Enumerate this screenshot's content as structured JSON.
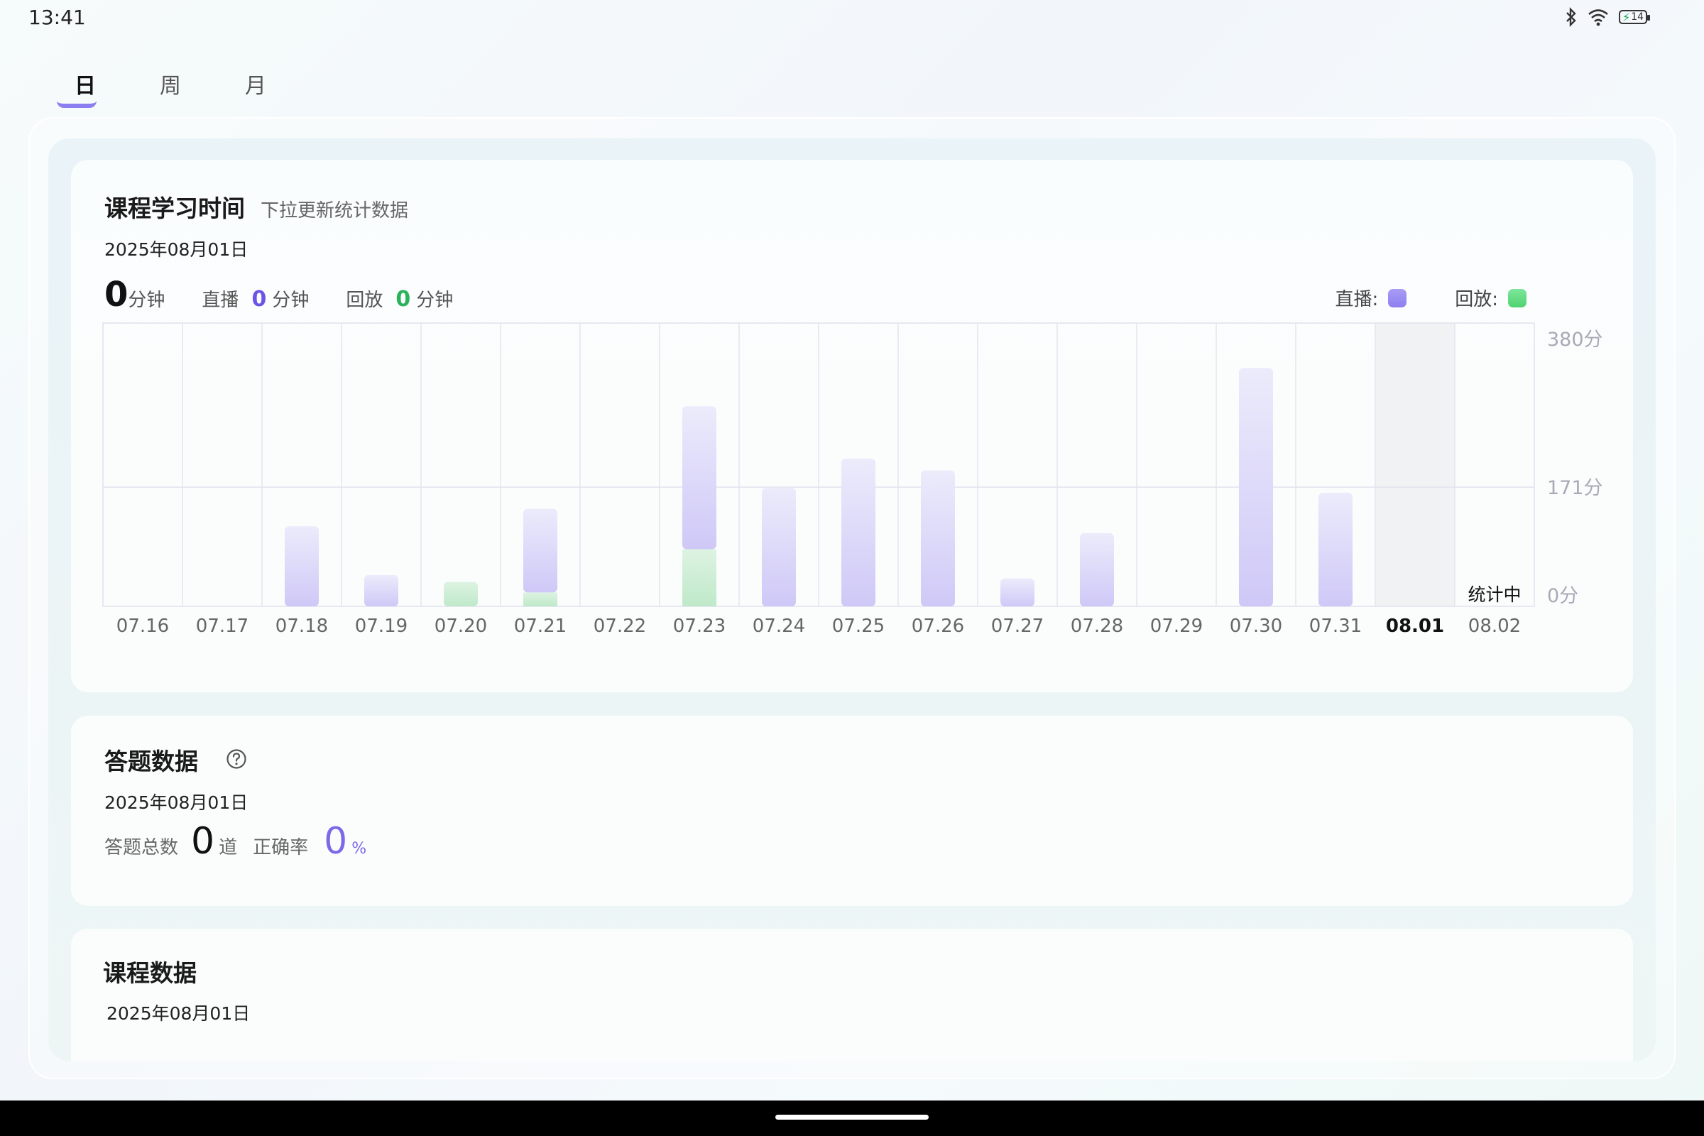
{
  "status_bar": {
    "time": "13:41",
    "battery": "14"
  },
  "tabs": [
    {
      "label": "日",
      "active": true
    },
    {
      "label": "周",
      "active": false
    },
    {
      "label": "月",
      "active": false
    }
  ],
  "study_time": {
    "title": "课程学习时间",
    "hint": "下拉更新统计数据",
    "date": "2025年08月01日",
    "total_value": "0",
    "total_unit": "分钟",
    "live_label": "直播",
    "live_value": "0",
    "live_unit": "分钟",
    "replay_label": "回放",
    "replay_value": "0",
    "replay_unit": "分钟",
    "legend_live": "直播:",
    "legend_replay": "回放:"
  },
  "chart_data": {
    "type": "bar",
    "stacked": true,
    "categories": [
      "07.16",
      "07.17",
      "07.18",
      "07.19",
      "07.20",
      "07.21",
      "07.22",
      "07.23",
      "07.24",
      "07.25",
      "07.26",
      "07.27",
      "07.28",
      "07.29",
      "07.30",
      "07.31",
      "08.01",
      "08.02"
    ],
    "series": [
      {
        "name": "直播",
        "color": "#9c90f2",
        "values": [
          0,
          0,
          115,
          45,
          0,
          120,
          0,
          205,
          170,
          212,
          195,
          40,
          105,
          0,
          342,
          163,
          0,
          0
        ]
      },
      {
        "name": "回放",
        "color": "#74e08f",
        "values": [
          0,
          0,
          0,
          0,
          35,
          20,
          0,
          82,
          0,
          0,
          0,
          0,
          0,
          0,
          0,
          0,
          0,
          0
        ]
      }
    ],
    "y_ticks": [
      "380分",
      "171分",
      "0分"
    ],
    "ylim": [
      0,
      380
    ],
    "highlight_category": "08.01",
    "highlight_label": "统计中"
  },
  "quiz": {
    "title": "答题数据",
    "date": "2025年08月01日",
    "total_label": "答题总数",
    "total_value": "0",
    "total_unit": "道",
    "accuracy_label": "正确率",
    "accuracy_value": "0",
    "accuracy_unit": "%"
  },
  "course": {
    "title": "课程数据",
    "date": "2025年08月01日"
  }
}
